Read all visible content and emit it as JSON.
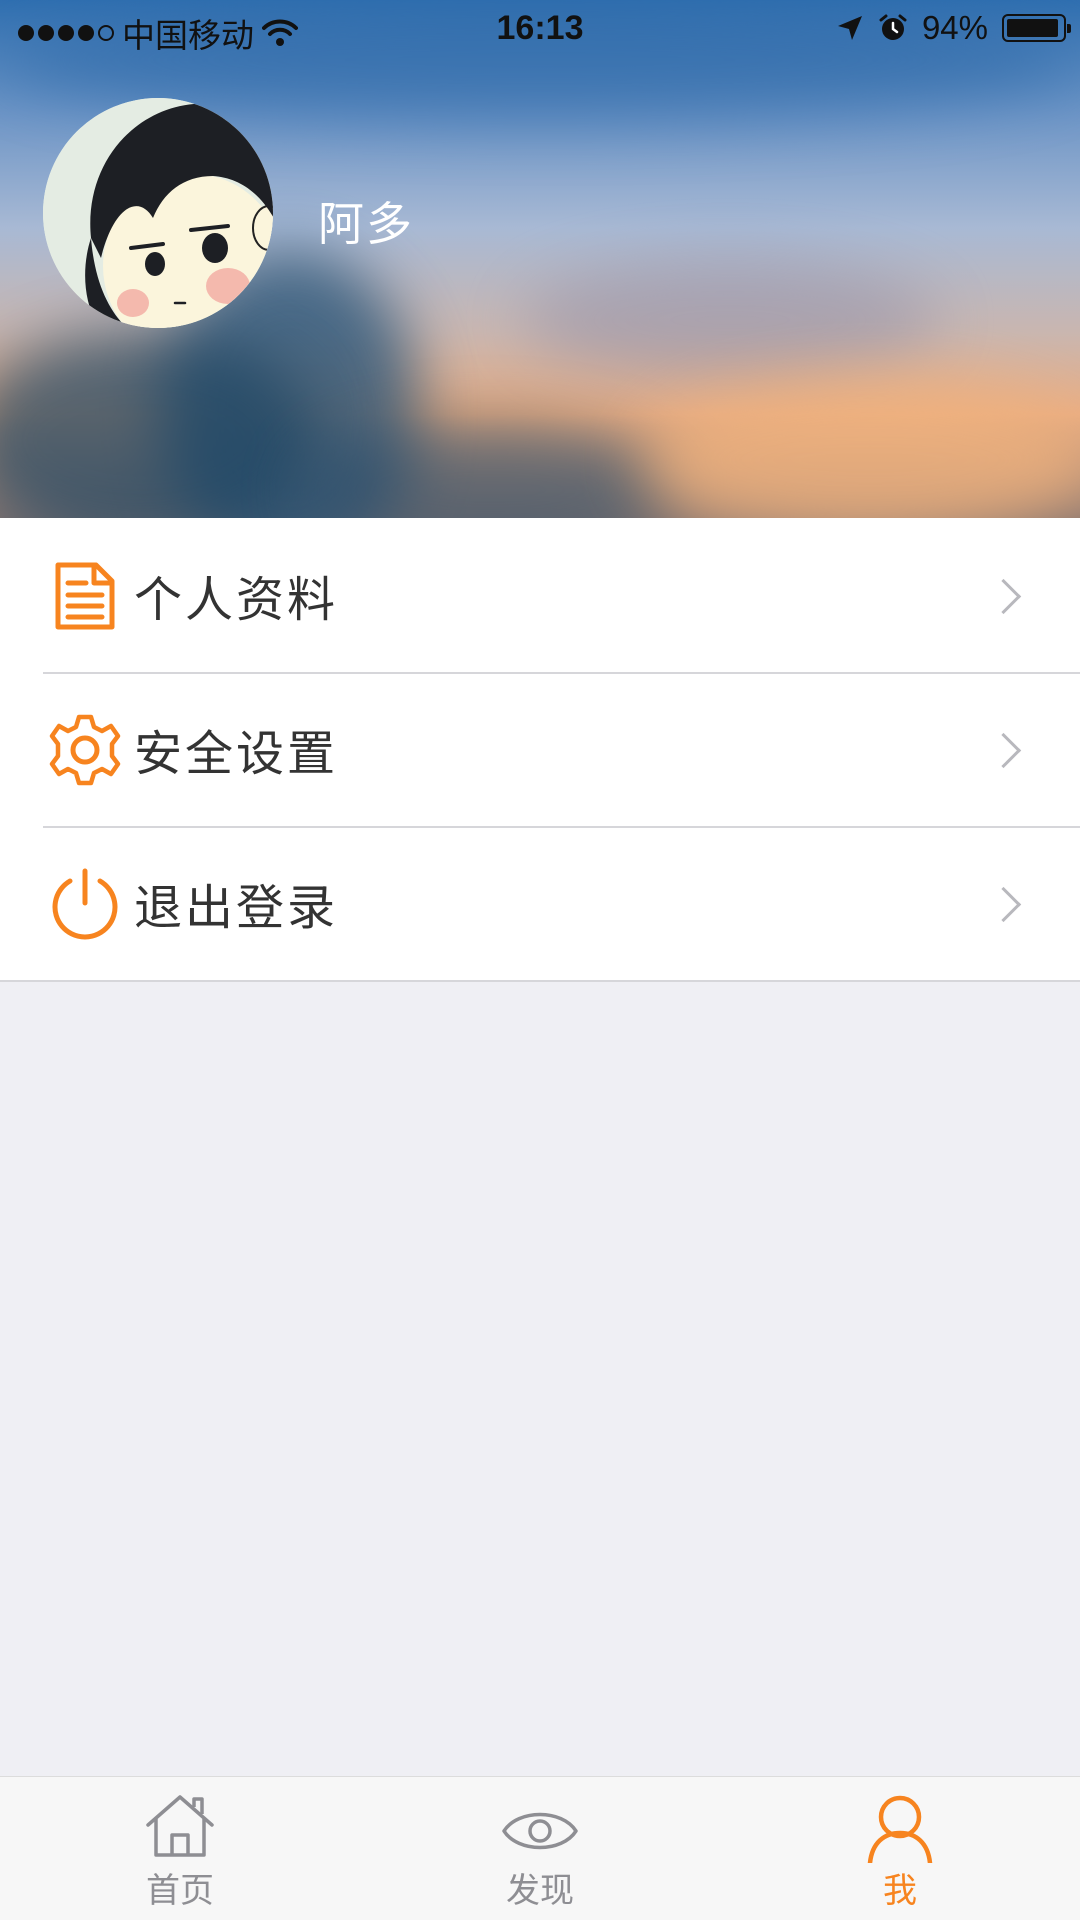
{
  "status_bar": {
    "carrier": "中国移动",
    "time": "16:13",
    "battery_percent": "94%",
    "battery_level": 0.94,
    "signal_dots_filled": 4,
    "signal_dots_total": 5
  },
  "profile": {
    "username": "阿多"
  },
  "menu": {
    "items": [
      {
        "label": "个人资料",
        "icon": "document-icon"
      },
      {
        "label": "安全设置",
        "icon": "gear-icon"
      },
      {
        "label": "退出登录",
        "icon": "power-icon"
      }
    ]
  },
  "tabbar": {
    "tabs": [
      {
        "label": "首页",
        "icon": "home-icon",
        "active": false
      },
      {
        "label": "发现",
        "icon": "eye-icon",
        "active": false
      },
      {
        "label": "我",
        "icon": "person-icon",
        "active": true
      }
    ]
  },
  "colors": {
    "accent": "#f7841f",
    "inactive": "#8e8e93",
    "background": "#efeff4",
    "menu_text": "#333333"
  }
}
